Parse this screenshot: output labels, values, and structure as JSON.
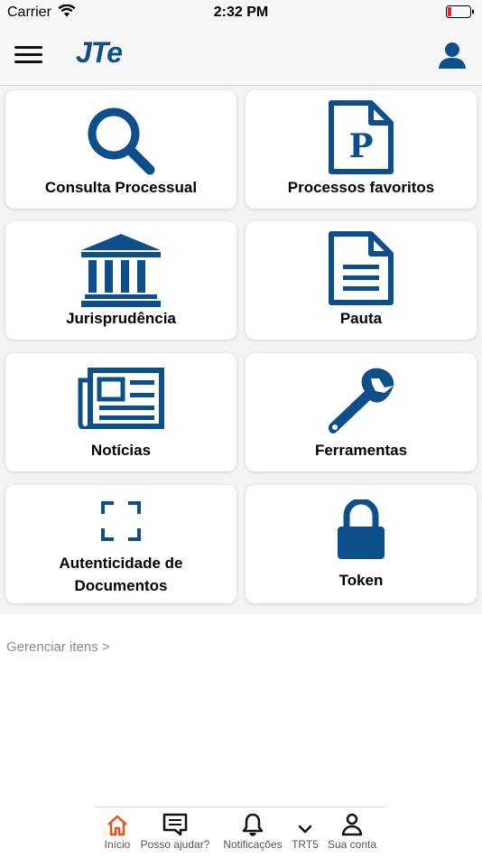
{
  "status": {
    "carrier": "Carrier",
    "time": "2:32 PM"
  },
  "nav": {
    "logo": "JTe"
  },
  "colors": {
    "accent": "#0d4f8b",
    "active_tab": "#e8501a"
  },
  "cards": [
    {
      "label": "Consulta Processual",
      "icon": "search-icon"
    },
    {
      "label": "Processos favoritos",
      "icon": "document-p-icon"
    },
    {
      "label": "Jurisprudência",
      "icon": "courthouse-icon"
    },
    {
      "label": "Pauta",
      "icon": "document-icon"
    },
    {
      "label": "Notícias",
      "icon": "newspaper-icon"
    },
    {
      "label": "Ferramentas",
      "icon": "wrench-icon"
    },
    {
      "label_line1": "Autenticidade de",
      "label_line2": "Documentos",
      "icon": "scan-frame-icon"
    },
    {
      "label": "Token",
      "icon": "lock-icon"
    }
  ],
  "manage_link": "Gerenciar itens >",
  "tabs": [
    {
      "label": "Início",
      "icon": "home-icon",
      "active": true
    },
    {
      "label": "Posso ajudar?",
      "icon": "chat-icon"
    },
    {
      "label": "Notificações",
      "icon": "bell-icon"
    },
    {
      "label": "TRT5",
      "icon": "chevron-down-icon"
    },
    {
      "label": "Sua conta",
      "icon": "user-icon"
    }
  ]
}
